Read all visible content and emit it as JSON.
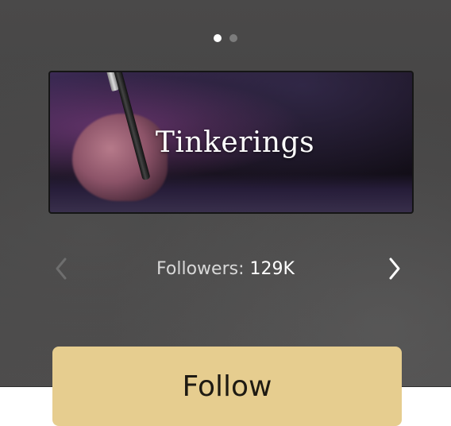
{
  "carousel": {
    "page_count": 2,
    "active_page": 1
  },
  "banner": {
    "title": "Tinkerings"
  },
  "nav": {
    "prev_icon": "chevron-left-icon",
    "next_icon": "chevron-right-icon"
  },
  "stats": {
    "followers_label": "Followers:",
    "followers_count": "129K"
  },
  "actions": {
    "follow_label": "Follow"
  },
  "colors": {
    "follow_button": "#e6cd8f",
    "overlay": "#4a4949",
    "dot_active": "#ffffff",
    "dot_inactive": "#7c7c7c"
  }
}
